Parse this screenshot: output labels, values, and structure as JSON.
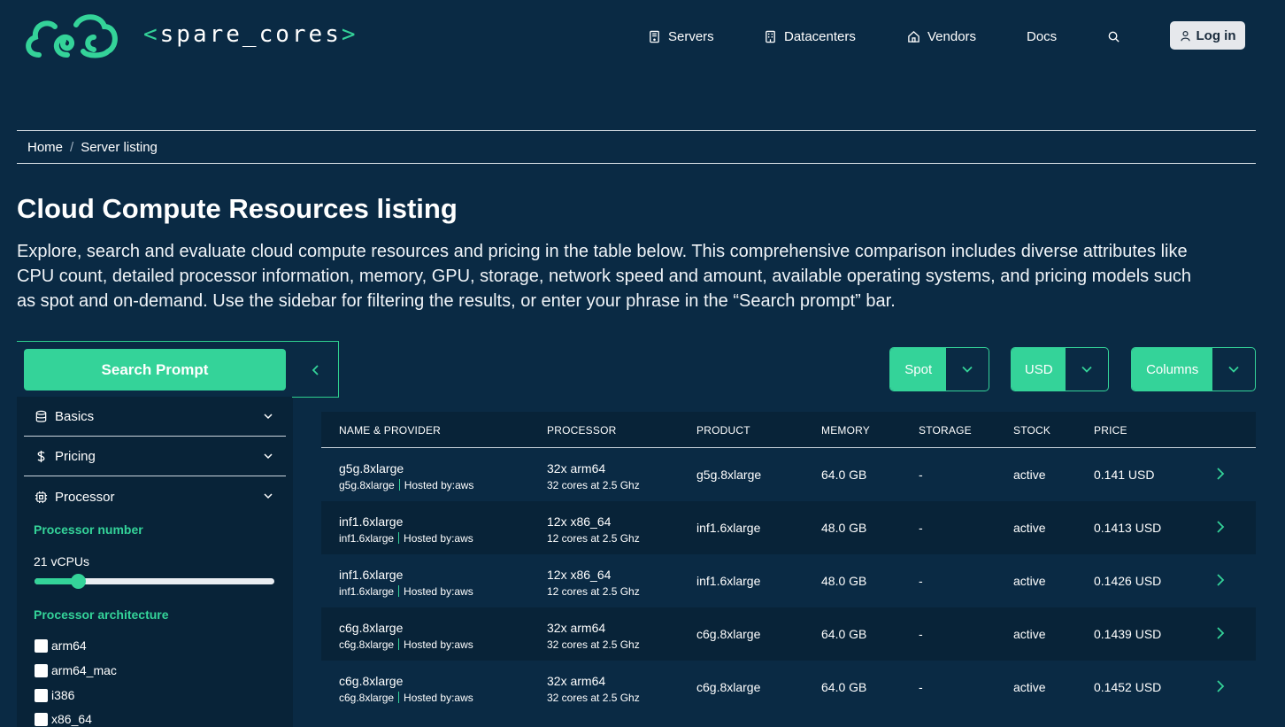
{
  "brand": {
    "logo_text_open": "<",
    "logo_text": "spare_cores",
    "logo_text_close": ">",
    "accent": "#34d399"
  },
  "nav": {
    "items": [
      {
        "label": "Servers",
        "icon": "server-icon"
      },
      {
        "label": "Datacenters",
        "icon": "building-icon"
      },
      {
        "label": "Vendors",
        "icon": "home-icon"
      },
      {
        "label": "Docs",
        "icon": ""
      }
    ],
    "search_icon": "search-icon",
    "login_label": "Log in"
  },
  "breadcrumb": {
    "home": "Home",
    "separator": "/",
    "current": "Server listing"
  },
  "page": {
    "title": "Cloud Compute Resources listing",
    "description": "Explore, search and evaluate cloud compute resources and pricing in the table below. This comprehensive comparison includes diverse attributes like CPU count, detailed processor information, memory, GPU, storage, network speed and amount, available operating systems, and pricing models such as spot and on-demand. Use the sidebar for filtering the results, or enter your phrase in the “Search prompt” bar."
  },
  "sidebar": {
    "search_prompt_label": "Search Prompt",
    "sections": [
      {
        "label": "Basics",
        "icon": "database-icon"
      },
      {
        "label": "Pricing",
        "icon": "dollar-icon"
      },
      {
        "label": "Processor",
        "icon": "cpu-icon"
      }
    ],
    "processor_number_label": "Processor number",
    "vcpu_value": "21 vCPUs",
    "vcpu_slider_fraction": 0.18,
    "architecture_label": "Processor architecture",
    "architectures": [
      "arm64",
      "arm64_mac",
      "i386",
      "x86_64"
    ]
  },
  "controls": {
    "allocation": "Spot",
    "currency": "USD",
    "columns": "Columns"
  },
  "table": {
    "headers": [
      "NAME & PROVIDER",
      "PROCESSOR",
      "PRODUCT",
      "MEMORY",
      "STORAGE",
      "STOCK",
      "PRICE"
    ],
    "hosted_prefix": "Hosted by:",
    "rows": [
      {
        "name": "g5g.8xlarge",
        "api": "g5g.8xlarge",
        "vendor": "aws",
        "proc": "32x arm64",
        "proc_detail": "32 cores at 2.5 Ghz",
        "product": "g5g.8xlarge",
        "memory": "64.0 GB",
        "storage": "-",
        "stock": "active",
        "price": "0.141 USD"
      },
      {
        "name": "inf1.6xlarge",
        "api": "inf1.6xlarge",
        "vendor": "aws",
        "proc": "12x x86_64",
        "proc_detail": "12 cores at 2.5 Ghz",
        "product": "inf1.6xlarge",
        "memory": "48.0 GB",
        "storage": "-",
        "stock": "active",
        "price": "0.1413 USD"
      },
      {
        "name": "inf1.6xlarge",
        "api": "inf1.6xlarge",
        "vendor": "aws",
        "proc": "12x x86_64",
        "proc_detail": "12 cores at 2.5 Ghz",
        "product": "inf1.6xlarge",
        "memory": "48.0 GB",
        "storage": "-",
        "stock": "active",
        "price": "0.1426 USD"
      },
      {
        "name": "c6g.8xlarge",
        "api": "c6g.8xlarge",
        "vendor": "aws",
        "proc": "32x arm64",
        "proc_detail": "32 cores at 2.5 Ghz",
        "product": "c6g.8xlarge",
        "memory": "64.0 GB",
        "storage": "-",
        "stock": "active",
        "price": "0.1439 USD"
      },
      {
        "name": "c6g.8xlarge",
        "api": "c6g.8xlarge",
        "vendor": "aws",
        "proc": "32x arm64",
        "proc_detail": "32 cores at 2.5 Ghz",
        "product": "c6g.8xlarge",
        "memory": "64.0 GB",
        "storage": "-",
        "stock": "active",
        "price": "0.1452 USD"
      }
    ]
  }
}
